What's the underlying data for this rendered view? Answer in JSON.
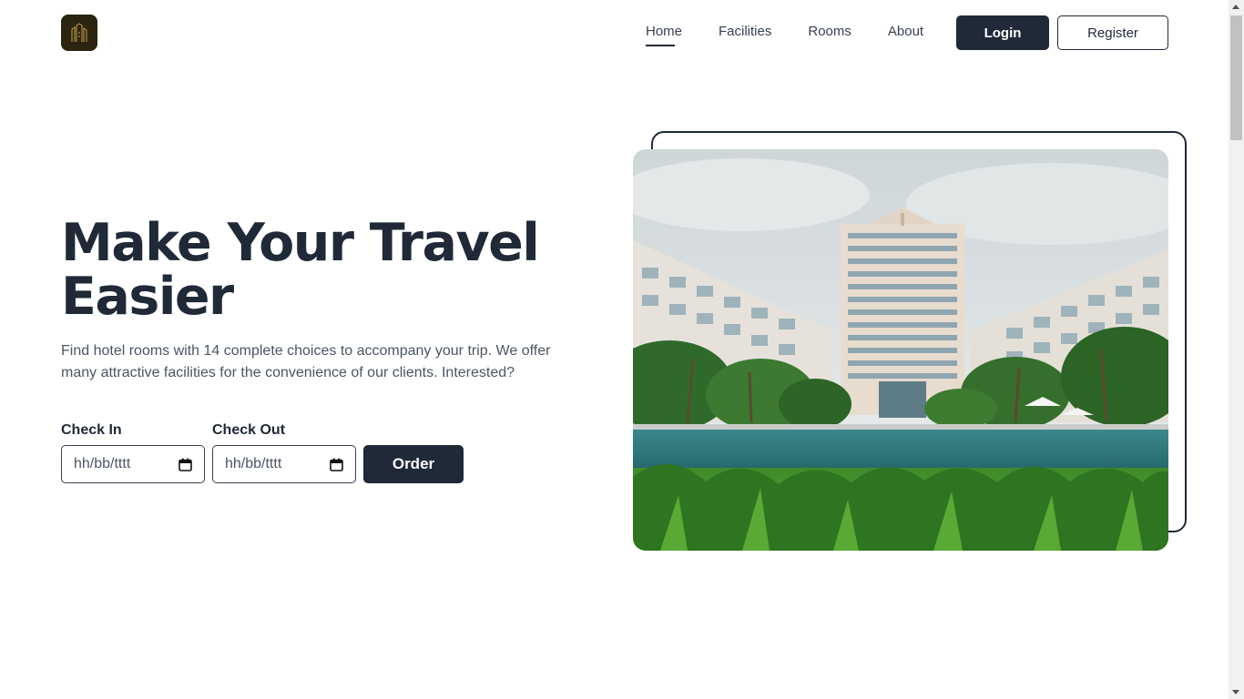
{
  "header": {
    "logo_icon": "hotel-logo-icon",
    "nav": [
      {
        "label": "Home",
        "active": true
      },
      {
        "label": "Facilities",
        "active": false
      },
      {
        "label": "Rooms",
        "active": false
      },
      {
        "label": "About",
        "active": false
      }
    ],
    "login_label": "Login",
    "register_label": "Register"
  },
  "hero": {
    "title_line1": "Make Your Travel",
    "title_line2": "Easier",
    "description": "Find hotel rooms with 14 complete choices to accompany your trip. We offer many attractive facilities for the convenience of our clients. Interested?",
    "check_in": {
      "label": "Check In",
      "placeholder": "hh/bb/tttt",
      "icon": "calendar-icon"
    },
    "check_out": {
      "label": "Check Out",
      "placeholder": "hh/bb/tttt",
      "icon": "calendar-icon"
    },
    "order_label": "Order",
    "image": "hotel-resort-photo"
  },
  "colors": {
    "primary": "#1f2937",
    "text_muted": "#4b5563",
    "background": "#ffffff"
  }
}
